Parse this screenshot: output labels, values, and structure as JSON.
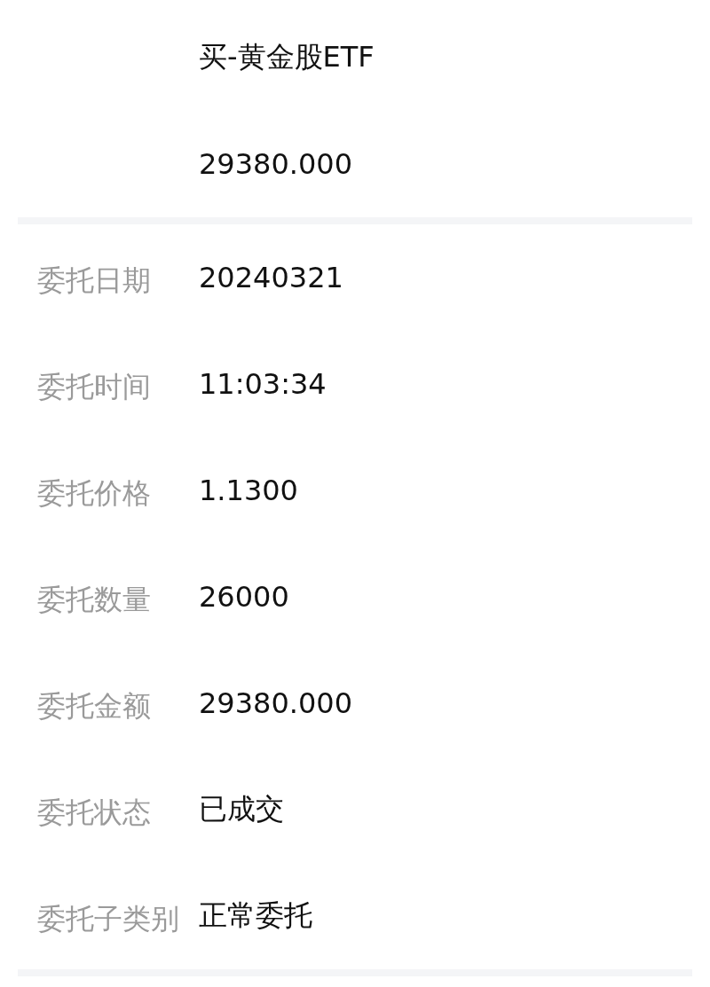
{
  "summary": [
    {
      "value": "买-黄金股ETF"
    },
    {
      "value": "29380.000"
    }
  ],
  "details": [
    {
      "label": "委托日期",
      "value": "20240321"
    },
    {
      "label": "委托时间",
      "value": "11:03:34"
    },
    {
      "label": "委托价格",
      "value": "1.1300"
    },
    {
      "label": "委托数量",
      "value": "26000"
    },
    {
      "label": "委托金额",
      "value": "29380.000"
    },
    {
      "label": "委托状态",
      "value": "已成交"
    },
    {
      "label": "委托子类别",
      "value": "正常委托"
    }
  ]
}
